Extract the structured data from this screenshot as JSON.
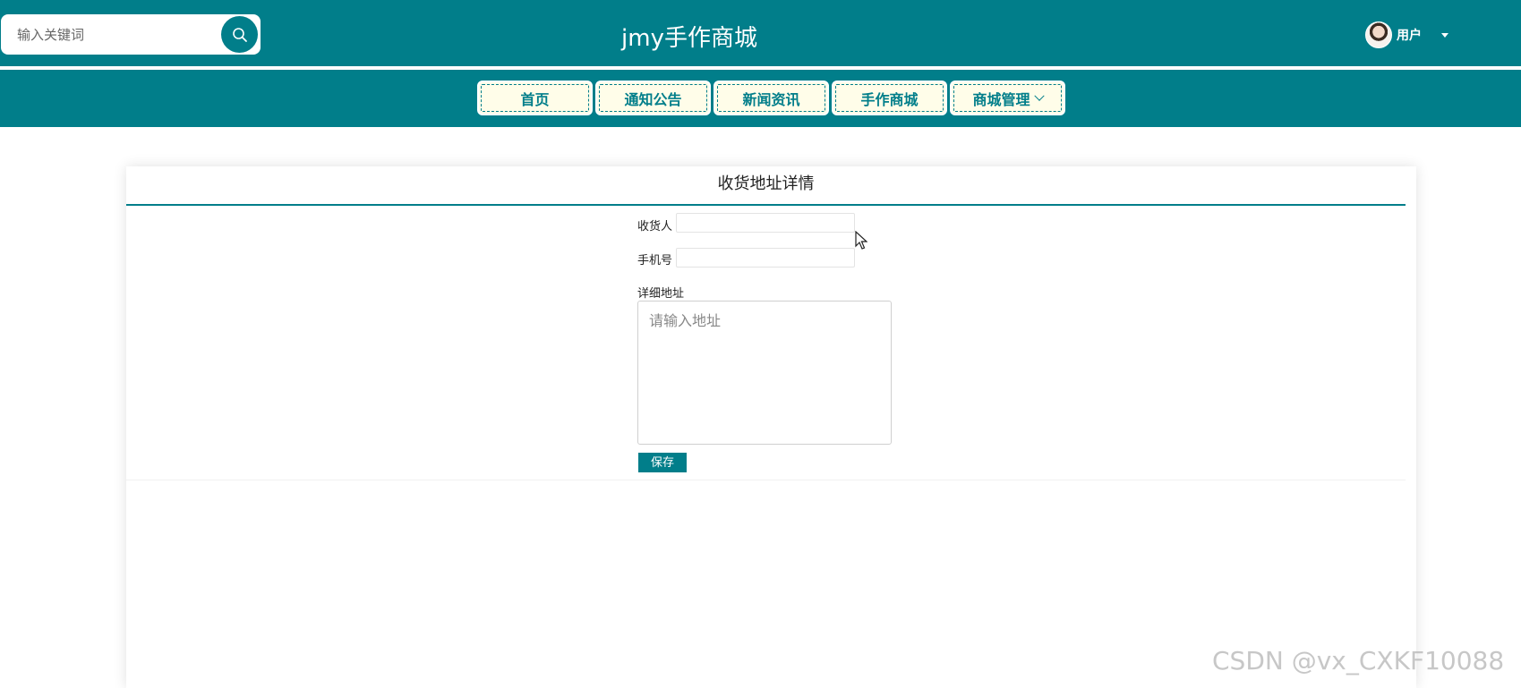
{
  "header": {
    "search_placeholder": "输入关键词",
    "site_title": "jmy手作商城",
    "user_label": "用户"
  },
  "nav": {
    "items": [
      {
        "label": "首页"
      },
      {
        "label": "通知公告"
      },
      {
        "label": "新闻资讯"
      },
      {
        "label": "手作商城"
      },
      {
        "label": "商城管理"
      }
    ]
  },
  "card": {
    "title": "收货地址详情",
    "fields": {
      "receiver_label": "收货人",
      "receiver_value": "",
      "phone_label": "手机号",
      "phone_value": "",
      "address_label": "详细地址",
      "address_placeholder": "请输入地址"
    },
    "save_label": "保存"
  },
  "watermark": "CSDN @vx_CXKF10088",
  "colors": {
    "primary": "#017e8a",
    "nav_button_bg": "#fffde9"
  },
  "icons": {
    "search": "search-icon",
    "dropdown": "chevron-down-icon",
    "user_caret": "caret-down-icon"
  }
}
